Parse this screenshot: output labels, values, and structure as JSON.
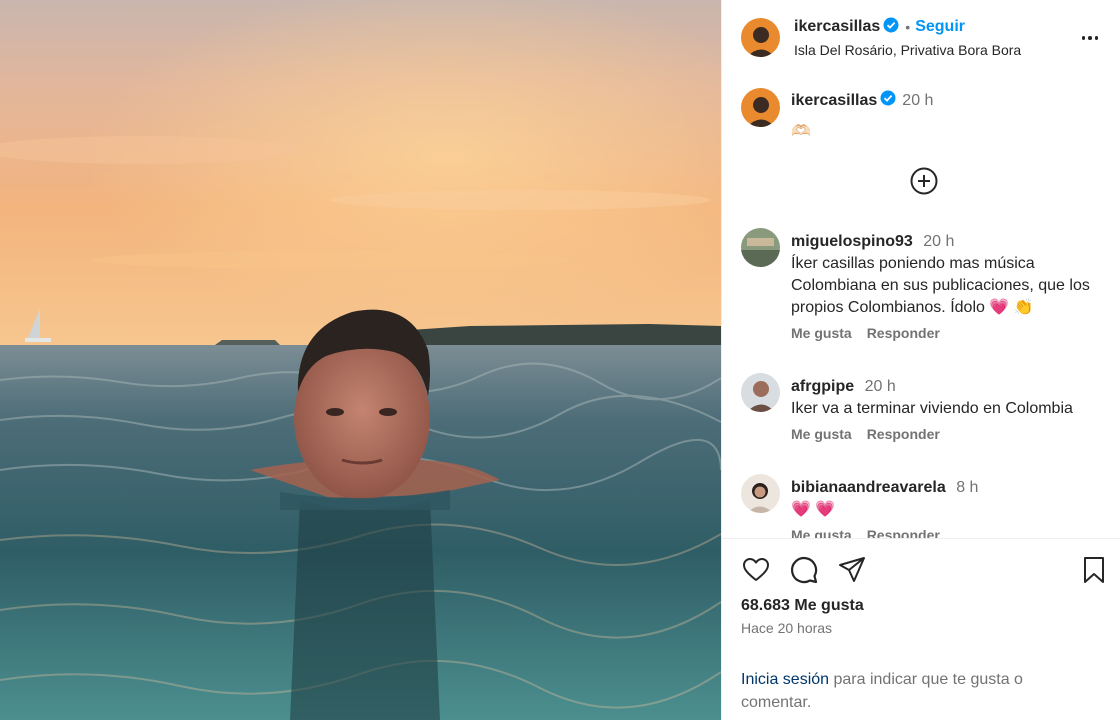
{
  "post": {
    "author": "ikercasillas",
    "follow_label": "Seguir",
    "separator": "•",
    "location": "Isla Del Rosário, Privativa Bora Bora"
  },
  "caption": {
    "author": "ikercasillas",
    "time": "20 h",
    "text": "🫶🏻"
  },
  "comments": [
    {
      "user": "miguelospino93",
      "time": "20 h",
      "text": "Íker casillas poniendo mas música Colombiana en sus publicaciones, que los propios Colombianos. Ídolo 💗 👏",
      "like_label": "Me gusta",
      "reply_label": "Responder"
    },
    {
      "user": "afrgpipe",
      "time": "20 h",
      "text": "Iker va a terminar viviendo en Colombia",
      "like_label": "Me gusta",
      "reply_label": "Responder"
    },
    {
      "user": "bibianaandreavarela",
      "time": "8 h",
      "text": "💗 💗",
      "like_label": "Me gusta",
      "reply_label": "Responder"
    }
  ],
  "stats": {
    "likes": "68.683 Me gusta",
    "posted_ago": "Hace 20 horas"
  },
  "login_prompt": {
    "link": "Inicia sesión",
    "text": " para indicar que te gusta o comentar."
  },
  "icons": {
    "verified": "verified-badge-icon",
    "more": "more-options-icon",
    "load_more": "plus-circle-icon",
    "like": "heart-icon",
    "comment": "comment-icon",
    "share": "send-icon",
    "save": "bookmark-icon"
  },
  "colors": {
    "accent": "#0095f6",
    "verified": "#0095f6",
    "link": "#00376b",
    "muted": "#737373"
  }
}
